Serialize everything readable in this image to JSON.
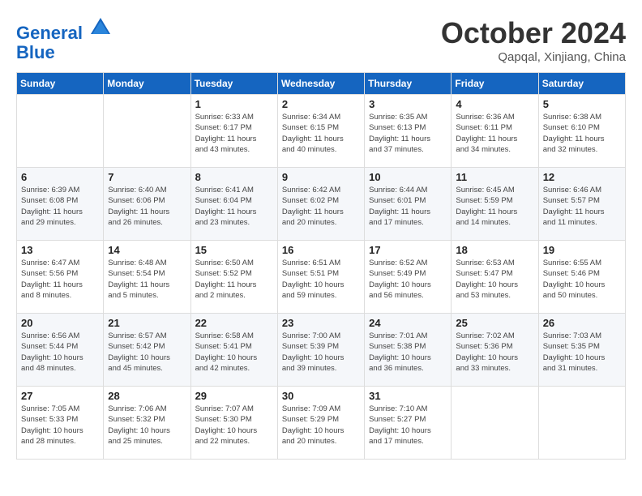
{
  "header": {
    "logo_line1": "General",
    "logo_line2": "Blue",
    "month_title": "October 2024",
    "subtitle": "Qapqal, Xinjiang, China"
  },
  "weekdays": [
    "Sunday",
    "Monday",
    "Tuesday",
    "Wednesday",
    "Thursday",
    "Friday",
    "Saturday"
  ],
  "weeks": [
    [
      {
        "num": "",
        "info": ""
      },
      {
        "num": "",
        "info": ""
      },
      {
        "num": "1",
        "info": "Sunrise: 6:33 AM\nSunset: 6:17 PM\nDaylight: 11 hours\nand 43 minutes."
      },
      {
        "num": "2",
        "info": "Sunrise: 6:34 AM\nSunset: 6:15 PM\nDaylight: 11 hours\nand 40 minutes."
      },
      {
        "num": "3",
        "info": "Sunrise: 6:35 AM\nSunset: 6:13 PM\nDaylight: 11 hours\nand 37 minutes."
      },
      {
        "num": "4",
        "info": "Sunrise: 6:36 AM\nSunset: 6:11 PM\nDaylight: 11 hours\nand 34 minutes."
      },
      {
        "num": "5",
        "info": "Sunrise: 6:38 AM\nSunset: 6:10 PM\nDaylight: 11 hours\nand 32 minutes."
      }
    ],
    [
      {
        "num": "6",
        "info": "Sunrise: 6:39 AM\nSunset: 6:08 PM\nDaylight: 11 hours\nand 29 minutes."
      },
      {
        "num": "7",
        "info": "Sunrise: 6:40 AM\nSunset: 6:06 PM\nDaylight: 11 hours\nand 26 minutes."
      },
      {
        "num": "8",
        "info": "Sunrise: 6:41 AM\nSunset: 6:04 PM\nDaylight: 11 hours\nand 23 minutes."
      },
      {
        "num": "9",
        "info": "Sunrise: 6:42 AM\nSunset: 6:02 PM\nDaylight: 11 hours\nand 20 minutes."
      },
      {
        "num": "10",
        "info": "Sunrise: 6:44 AM\nSunset: 6:01 PM\nDaylight: 11 hours\nand 17 minutes."
      },
      {
        "num": "11",
        "info": "Sunrise: 6:45 AM\nSunset: 5:59 PM\nDaylight: 11 hours\nand 14 minutes."
      },
      {
        "num": "12",
        "info": "Sunrise: 6:46 AM\nSunset: 5:57 PM\nDaylight: 11 hours\nand 11 minutes."
      }
    ],
    [
      {
        "num": "13",
        "info": "Sunrise: 6:47 AM\nSunset: 5:56 PM\nDaylight: 11 hours\nand 8 minutes."
      },
      {
        "num": "14",
        "info": "Sunrise: 6:48 AM\nSunset: 5:54 PM\nDaylight: 11 hours\nand 5 minutes."
      },
      {
        "num": "15",
        "info": "Sunrise: 6:50 AM\nSunset: 5:52 PM\nDaylight: 11 hours\nand 2 minutes."
      },
      {
        "num": "16",
        "info": "Sunrise: 6:51 AM\nSunset: 5:51 PM\nDaylight: 10 hours\nand 59 minutes."
      },
      {
        "num": "17",
        "info": "Sunrise: 6:52 AM\nSunset: 5:49 PM\nDaylight: 10 hours\nand 56 minutes."
      },
      {
        "num": "18",
        "info": "Sunrise: 6:53 AM\nSunset: 5:47 PM\nDaylight: 10 hours\nand 53 minutes."
      },
      {
        "num": "19",
        "info": "Sunrise: 6:55 AM\nSunset: 5:46 PM\nDaylight: 10 hours\nand 50 minutes."
      }
    ],
    [
      {
        "num": "20",
        "info": "Sunrise: 6:56 AM\nSunset: 5:44 PM\nDaylight: 10 hours\nand 48 minutes."
      },
      {
        "num": "21",
        "info": "Sunrise: 6:57 AM\nSunset: 5:42 PM\nDaylight: 10 hours\nand 45 minutes."
      },
      {
        "num": "22",
        "info": "Sunrise: 6:58 AM\nSunset: 5:41 PM\nDaylight: 10 hours\nand 42 minutes."
      },
      {
        "num": "23",
        "info": "Sunrise: 7:00 AM\nSunset: 5:39 PM\nDaylight: 10 hours\nand 39 minutes."
      },
      {
        "num": "24",
        "info": "Sunrise: 7:01 AM\nSunset: 5:38 PM\nDaylight: 10 hours\nand 36 minutes."
      },
      {
        "num": "25",
        "info": "Sunrise: 7:02 AM\nSunset: 5:36 PM\nDaylight: 10 hours\nand 33 minutes."
      },
      {
        "num": "26",
        "info": "Sunrise: 7:03 AM\nSunset: 5:35 PM\nDaylight: 10 hours\nand 31 minutes."
      }
    ],
    [
      {
        "num": "27",
        "info": "Sunrise: 7:05 AM\nSunset: 5:33 PM\nDaylight: 10 hours\nand 28 minutes."
      },
      {
        "num": "28",
        "info": "Sunrise: 7:06 AM\nSunset: 5:32 PM\nDaylight: 10 hours\nand 25 minutes."
      },
      {
        "num": "29",
        "info": "Sunrise: 7:07 AM\nSunset: 5:30 PM\nDaylight: 10 hours\nand 22 minutes."
      },
      {
        "num": "30",
        "info": "Sunrise: 7:09 AM\nSunset: 5:29 PM\nDaylight: 10 hours\nand 20 minutes."
      },
      {
        "num": "31",
        "info": "Sunrise: 7:10 AM\nSunset: 5:27 PM\nDaylight: 10 hours\nand 17 minutes."
      },
      {
        "num": "",
        "info": ""
      },
      {
        "num": "",
        "info": ""
      }
    ]
  ]
}
